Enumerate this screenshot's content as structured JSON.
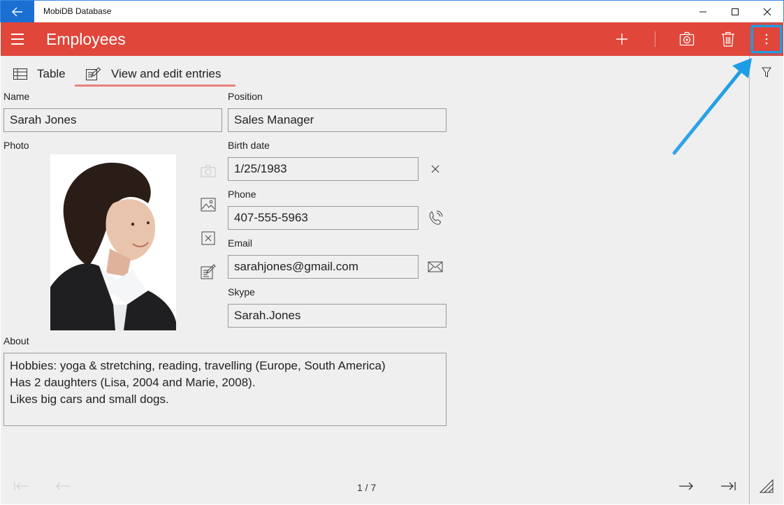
{
  "window": {
    "title": "MobiDB Database",
    "controls": [
      "minimize",
      "maximize",
      "close"
    ]
  },
  "appbar": {
    "title": "Employees",
    "actions": [
      "add-icon",
      "camera-icon",
      "trash-icon",
      "more-icon"
    ],
    "accent_color": "#e0463a"
  },
  "tabs": [
    {
      "label": "Table",
      "active": false
    },
    {
      "label": "View and edit entries",
      "active": true
    }
  ],
  "form": {
    "name_label": "Name",
    "name_value": "Sarah Jones",
    "position_label": "Position",
    "position_value": "Sales Manager",
    "photo_label": "Photo",
    "birth_label": "Birth date",
    "birth_value": "1/25/1983",
    "phone_label": "Phone",
    "phone_value": "407-555-5963",
    "email_label": "Email",
    "email_value": "sarahjones@gmail.com",
    "skype_label": "Skype",
    "skype_value": "Sarah.Jones",
    "about_label": "About",
    "about_lines": [
      "Hobbies: yoga & stretching, reading, travelling (Europe, South America)",
      "Has 2 daughters (Lisa, 2004 and Marie, 2008).",
      "Likes big cars and small dogs."
    ]
  },
  "pager": {
    "text": "1 / 7"
  },
  "highlight_color": "#1d9de6"
}
